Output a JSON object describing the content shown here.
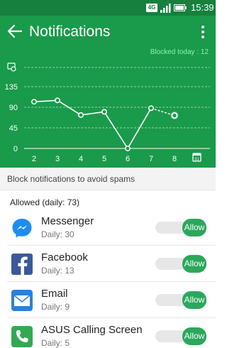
{
  "status_bar": {
    "network": "4G",
    "time": "15:39"
  },
  "header": {
    "title": "Notifications"
  },
  "chart_header": {
    "blocked_today_label": "Blocked today :",
    "blocked_today_count": "12"
  },
  "chart_data": {
    "type": "line",
    "x": [
      "2",
      "3",
      "4",
      "5",
      "6",
      "7",
      "8"
    ],
    "values": [
      102,
      105,
      73,
      80,
      0,
      88,
      72
    ],
    "y_ticks": [
      "0",
      "45",
      "90",
      "135"
    ],
    "ylim": [
      0,
      180
    ],
    "last_point_estimated": true,
    "grid": true,
    "legend": "none"
  },
  "banner": {
    "text": "Block notifications to avoid spams"
  },
  "allowed": {
    "header": "Allowed (daily: 73)"
  },
  "apps": [
    {
      "name": "Messenger",
      "daily": "Daily: 30",
      "toggle": "Allow",
      "icon": "messenger-icon"
    },
    {
      "name": "Facebook",
      "daily": "Daily: 13",
      "toggle": "Allow",
      "icon": "facebook-icon"
    },
    {
      "name": "Email",
      "daily": "Daily: 9",
      "toggle": "Allow",
      "icon": "email-icon"
    },
    {
      "name": "ASUS Calling Screen",
      "daily": "Daily: 5",
      "toggle": "Allow",
      "icon": "phone-icon"
    }
  ],
  "colors": {
    "primary": "#1a9a4b",
    "status": "#16803e",
    "accent_text": "#8ef2b0",
    "toggle_on": "#2aa85b"
  }
}
